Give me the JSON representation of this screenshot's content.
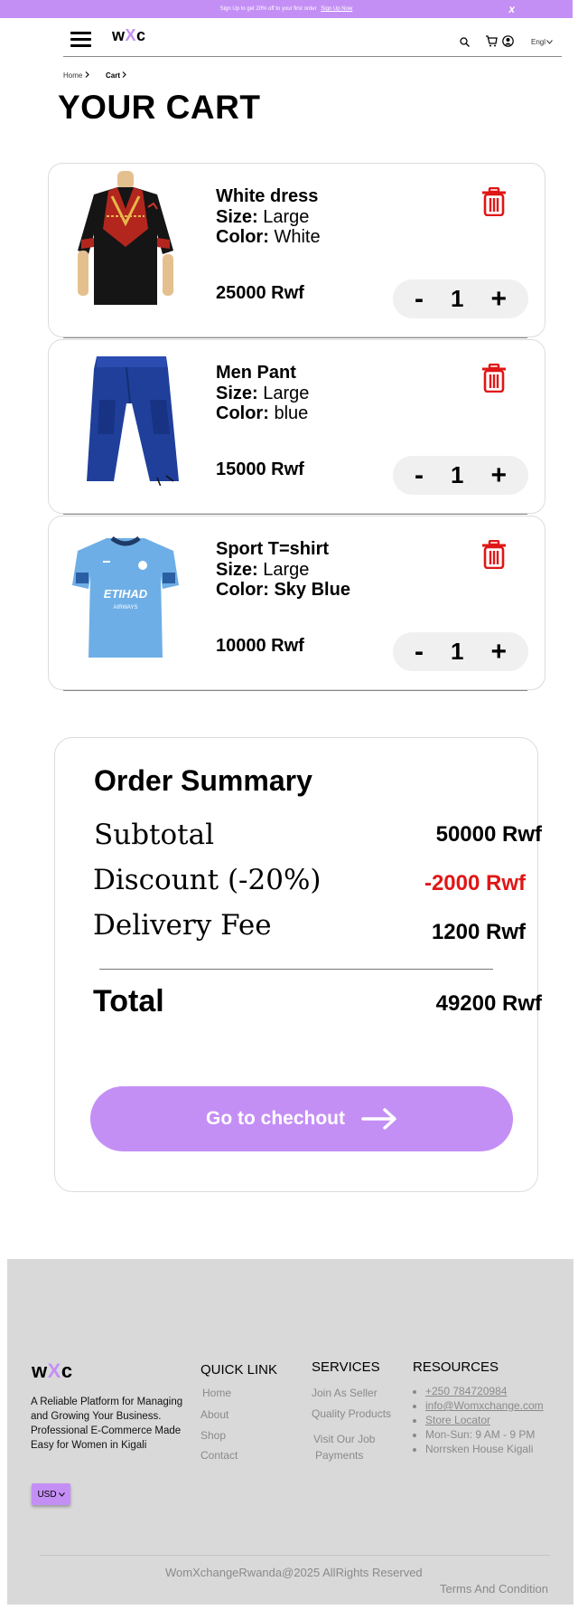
{
  "banner": {
    "text": "Sign Up to get 20% off to your first order",
    "link": "Sign Up Now",
    "close": "x"
  },
  "header": {
    "logo_pre": "w",
    "logo_x": "X",
    "logo_post": "c",
    "language": "Engl"
  },
  "breadcrumb": [
    "Home",
    "Cart"
  ],
  "page_title": "YOUR CART",
  "cart": {
    "items": [
      {
        "name": "White dress",
        "size_label": "Size:",
        "size": "Large",
        "color_label": "Color:",
        "color": "White",
        "price": "25000 Rwf",
        "qty": "1"
      },
      {
        "name": "Men  Pant",
        "size_label": "Size:",
        "size": "Large",
        "color_label": "Color:",
        "color": "blue",
        "price": "15000 Rwf",
        "qty": "1"
      },
      {
        "name": "Sport T=shirt",
        "size_label": "Size:",
        "size": "Large",
        "color_label": "Color:",
        "color": "Sky Blue",
        "price": "10000 Rwf",
        "qty": "1"
      }
    ],
    "minus": "-",
    "plus": "+"
  },
  "summary": {
    "title": "Order Summary",
    "subtotal_label": "Subtotal",
    "subtotal": "50000 Rwf",
    "discount_label": "Discount (-20%)",
    "discount": "-2000 Rwf",
    "delivery_label": "Delivery Fee",
    "delivery": "1200 Rwf",
    "total_label": "Total",
    "total": "49200 Rwf",
    "checkout": "Go to chechout"
  },
  "footer": {
    "logo_pre": "w",
    "logo_x": "X",
    "logo_post": "c",
    "description": "A Reliable Platform for Managing and Growing Your Business. Professional E-Commerce Made Easy for Women in Kigali",
    "currency": "USD",
    "quick_link": {
      "title": "QUICK LINK",
      "items": [
        "Home",
        "About",
        "Shop",
        "Contact"
      ]
    },
    "services": {
      "title": "SERVICES",
      "items": [
        "Join As Seller",
        "Quality Products",
        "Visit Our Job",
        "Payments"
      ]
    },
    "resources": {
      "title": "RESOURCES",
      "items": [
        "+250 784720984",
        "info@Womxchange.com",
        "Store Locator",
        "Mon-Sun: 9 AM - 9 PM",
        "Norrsken House Kigali"
      ]
    },
    "copyright": "WomXchangeRwanda@2025 AllRights Reserved",
    "terms": "Terms And Condition"
  },
  "colors": {
    "accent": "#c48ff5",
    "danger": "#e01616",
    "footer_bg": "#d9d9d9"
  }
}
